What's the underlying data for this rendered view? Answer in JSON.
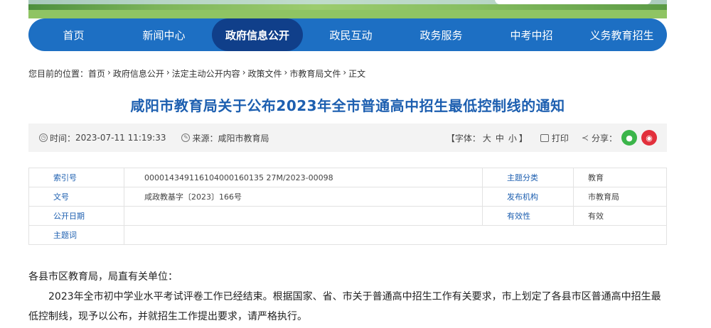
{
  "nav": {
    "items": [
      {
        "label": "首页",
        "name": "nav-home"
      },
      {
        "label": "新闻中心",
        "name": "nav-news"
      },
      {
        "label": "政府信息公开",
        "name": "nav-gov-info",
        "active": true
      },
      {
        "label": "政民互动",
        "name": "nav-interaction"
      },
      {
        "label": "政务服务",
        "name": "nav-services"
      },
      {
        "label": "中考中招",
        "name": "nav-exam"
      },
      {
        "label": "义务教育招生",
        "name": "nav-enrollment"
      }
    ]
  },
  "breadcrumb": {
    "prefix": "您目前的位置：",
    "items": [
      "首页",
      "政府信息公开",
      "法定主动公开内容",
      "政策文件",
      "市教育局文件",
      "正文"
    ],
    "separator": "›"
  },
  "article": {
    "title": "咸阳市教育局关于公布2023年全市普通高中招生最低控制线的通知",
    "time_label": "时间：",
    "time": "2023-07-11 11:19:33",
    "source_label": "来源：",
    "source": "咸阳市教育局",
    "font_size_label": "【字体：",
    "font_sizes": [
      "大",
      "中",
      "小"
    ],
    "font_size_close": "】",
    "print_label": "打印",
    "share_label": "分享："
  },
  "info_table": {
    "rows": [
      {
        "label": "索引号",
        "value": "000014349116104000160135 27M/2023-00098",
        "label2": "主题分类",
        "value2": "教育"
      },
      {
        "label": "文号",
        "value": "咸政教基字〔2023〕166号",
        "label2": "发布机构",
        "value2": "市教育局"
      },
      {
        "label": "公开日期",
        "value": "",
        "label2": "有效性",
        "value2": "有效"
      },
      {
        "label": "主题词",
        "value": ""
      }
    ]
  },
  "content": {
    "salutation": "各县市区教育局，局直有关单位：",
    "paragraph1": "2023年全市初中学业水平考试评卷工作已经结束。根据国家、省、市关于普通高中招生工作有关要求，市上划定了各县市区普通高中招生最低控制线，现予以公布，并就招生工作提出要求，请严格执行。"
  },
  "icons": {
    "clock": "clock-icon",
    "source": "pen-icon",
    "print": "printer-icon",
    "share": "share-icon",
    "wechat": "wechat-icon",
    "weibo": "weibo-icon"
  }
}
